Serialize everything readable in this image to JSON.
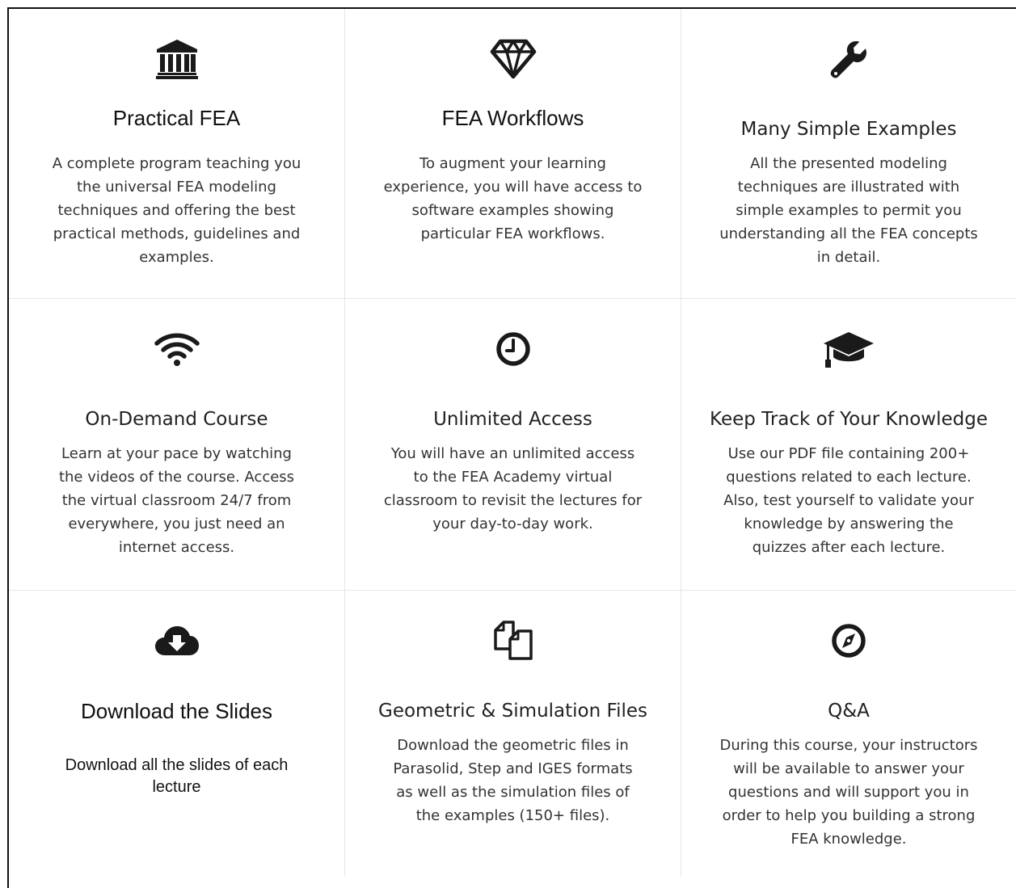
{
  "features": [
    {
      "icon": "bank-icon",
      "title": "Practical FEA",
      "description": "A complete program teaching you the universal FEA modeling techniques and offering the best practical methods, guidelines and examples."
    },
    {
      "icon": "diamond-icon",
      "title": "FEA Workflows",
      "description": "To augment your learning experience, you will have access to software examples showing particular FEA workflows."
    },
    {
      "icon": "wrench-icon",
      "title": "Many Simple Examples",
      "description": "All the presented modeling techniques are illustrated with simple examples to permit you understanding all the FEA concepts in detail."
    },
    {
      "icon": "wifi-icon",
      "title": "On-Demand Course",
      "description": "Learn at your pace by watching the videos of the course. Access the virtual classroom 24/7 from everywhere, you just need an internet access."
    },
    {
      "icon": "clock-icon",
      "title": "Unlimited Access",
      "description": "You will have an unlimited access to the FEA Academy virtual classroom to revisit the lectures for your day-to-day work."
    },
    {
      "icon": "graduation-cap-icon",
      "title": "Keep Track of Your Knowledge",
      "description": "Use our PDF file containing 200+ questions related to each lecture. Also, test yourself to validate your knowledge by answering the quizzes after each lecture."
    },
    {
      "icon": "cloud-download-icon",
      "title": "Download the Slides",
      "description": "Download all the slides of each lecture"
    },
    {
      "icon": "copy-files-icon",
      "title": "Geometric & Simulation Files",
      "description": "Download the geometric files in Parasolid, Step and IGES formats as well as the simulation files of the examples (150+ files)."
    },
    {
      "icon": "compass-icon",
      "title": "Q&A",
      "description": "During this course, your instructors will be available to answer your questions and will support you in order to help you building a strong FEA knowledge."
    }
  ]
}
